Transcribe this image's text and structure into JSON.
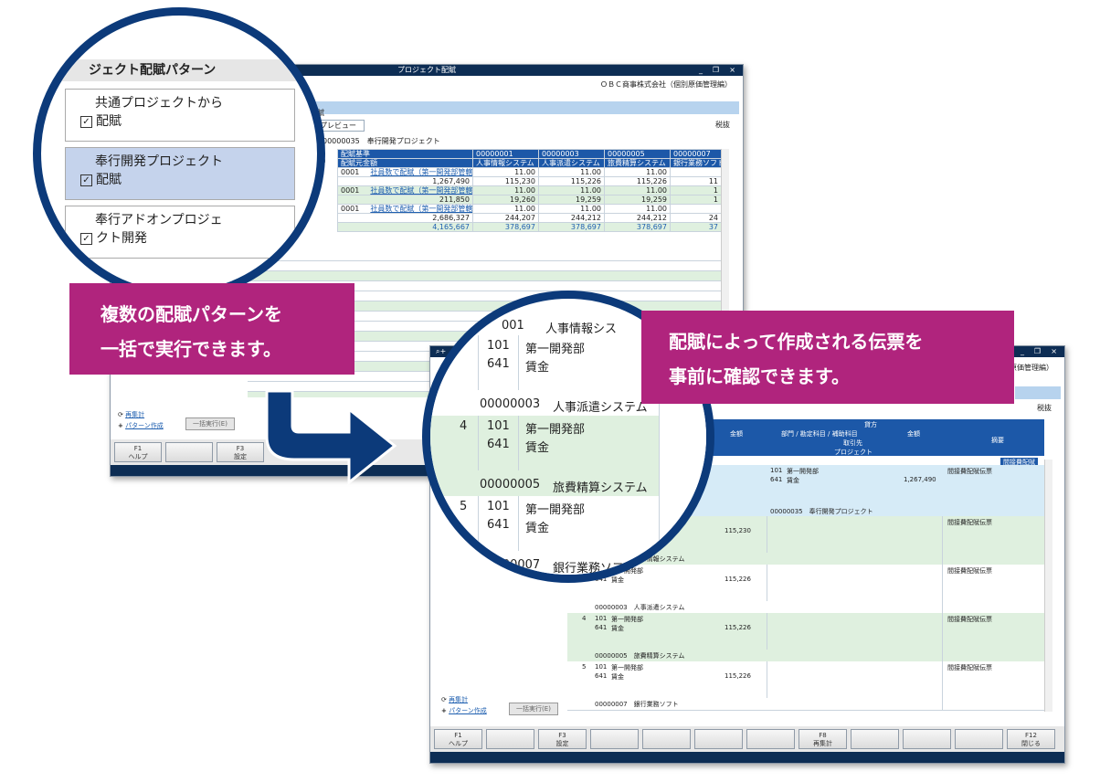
{
  "window1": {
    "title": "プロジェクト配賦",
    "company": "ＯＢＣ商事株式会社（個別原価管理編）",
    "section_label": "配賦",
    "tab_label": "プレビュー",
    "tax_label": "税抜",
    "project_line": "00000035　奉行開発プロジェクト",
    "name_label": "名",
    "headers": {
      "basis": "配賦基準",
      "source_amount": "配賦元金額",
      "cols": [
        {
          "code": "00000001",
          "name": "人事情報システム"
        },
        {
          "code": "00000003",
          "name": "人事派遣システム"
        },
        {
          "code": "00000005",
          "name": "旅費精算システム"
        },
        {
          "code": "00000007",
          "name": "銀行業務ソフト"
        }
      ]
    },
    "rows": [
      {
        "code": "0001",
        "basis": "社員数で配賦（第一開発部管轄）",
        "vals": [
          "11.00",
          "11.00",
          "11.00",
          ""
        ],
        "amount": "1,267,490",
        "amts": [
          "115,230",
          "115,226",
          "115,226",
          "11"
        ],
        "green": false
      },
      {
        "code": "0001",
        "basis": "社員数で配賦（第一開発部管轄）",
        "vals": [
          "11.00",
          "11.00",
          "11.00",
          "1"
        ],
        "amount": "211,850",
        "amts": [
          "19,260",
          "19,259",
          "19,259",
          "1"
        ],
        "green": true
      },
      {
        "code": "0001",
        "basis": "社員数で配賦（第一開発部管轄）",
        "vals": [
          "11.00",
          "11.00",
          "11.00",
          ""
        ],
        "amount": "2,686,327",
        "amts": [
          "244,207",
          "244,212",
          "244,212",
          "24"
        ],
        "green": false
      }
    ],
    "total": {
      "amount": "4,165,667",
      "amts": [
        "378,697",
        "378,697",
        "378,697",
        "37"
      ]
    },
    "recalc_link": "再集計",
    "pattern_link": "パターン作成",
    "batch_button": "一括実行(E)",
    "fkeys": [
      {
        "key": "F1",
        "label": "ヘルプ"
      },
      {
        "key": "",
        "label": ""
      },
      {
        "key": "F3",
        "label": "設定"
      }
    ]
  },
  "zoom1": {
    "title": "ジェクト配賦パターン",
    "items": [
      {
        "lines": [
          "共通プロジェクトから",
          "配賦"
        ],
        "checked": true,
        "selected": false
      },
      {
        "lines": [
          "奉行開発プロジェクト",
          "配賦"
        ],
        "checked": true,
        "selected": true
      },
      {
        "lines": [
          "奉行アドオンプロジェ",
          "クト開発"
        ],
        "checked": true,
        "selected": false
      }
    ]
  },
  "callout1": {
    "line1": "複数の配賦パターンを",
    "line2": "一括で実行できます。"
  },
  "callout2": {
    "line1": "配賦によって作成される伝票を",
    "line2": "事前に確認できます。"
  },
  "zoom2": {
    "top_code": "001",
    "top_name": "人事情報シス",
    "blocks": [
      {
        "num": "",
        "rows": [
          [
            "101",
            "第一開発部"
          ],
          [
            "641",
            "賃金"
          ]
        ],
        "code": "00000003",
        "name": "人事派遣システム",
        "green": false
      },
      {
        "num": "4",
        "rows": [
          [
            "101",
            "第一開発部"
          ],
          [
            "641",
            "賃金"
          ]
        ],
        "code": "00000005",
        "name": "旅費精算システム",
        "green": true
      },
      {
        "num": "5",
        "rows": [
          [
            "101",
            "第一開発部"
          ],
          [
            "641",
            "賃金"
          ]
        ],
        "code": "00000007",
        "name": "銀行業務ソフト",
        "green": false
      }
    ]
  },
  "window2": {
    "company": "個別原価管理編）",
    "tax_label": "税抜",
    "credit_header": "貸方",
    "sub_header": "部門 / 勘定科目 / 補助科目",
    "amount_header": "金額",
    "partner_header": "取引先",
    "project_header": "プロジェクト",
    "summary_header": "摘要",
    "debit_amount_header": "金額",
    "badge": "間接費配賦",
    "first": {
      "dept": "101",
      "dept_name": "第一開発部",
      "acct": "641",
      "acct_name": "賃金",
      "amount": "1,267,490",
      "summary": "間接費配賦伝票",
      "project": "00000035　奉行開発プロジェクト"
    },
    "entries": [
      {
        "num": "",
        "amount": "115,230",
        "project": "00000001　人事情報システム",
        "summary": "間接費配賦伝票",
        "green": true
      },
      {
        "num": "",
        "amount": "115,226",
        "project": "00000003　人事派遣システム",
        "summary": "間接費配賦伝票",
        "green": false
      },
      {
        "num": "4",
        "amount": "115,226",
        "project": "00000005　旅費精算システム",
        "summary": "間接費配賦伝票",
        "green": true
      },
      {
        "num": "5",
        "amount": "115,226",
        "project": "00000007　銀行業務ソフト",
        "summary": "間接費配賦伝票",
        "green": false
      }
    ],
    "dept": "101",
    "dept_name": "第一開発部",
    "acct": "641",
    "acct_name": "賃金",
    "recalc_link": "再集計",
    "pattern_link": "パターン作成",
    "batch_button": "一括実行(E)",
    "fkeys": [
      {
        "key": "F1",
        "label": "ヘルプ"
      },
      {
        "key": "",
        "label": ""
      },
      {
        "key": "F3",
        "label": "設定"
      },
      {
        "key": "",
        "label": ""
      },
      {
        "key": "",
        "label": ""
      },
      {
        "key": "",
        "label": ""
      },
      {
        "key": "",
        "label": ""
      },
      {
        "key": "F8",
        "label": "再集計"
      },
      {
        "key": "",
        "label": ""
      },
      {
        "key": "",
        "label": ""
      },
      {
        "key": "",
        "label": ""
      },
      {
        "key": "F12",
        "label": "閉じる"
      }
    ]
  }
}
